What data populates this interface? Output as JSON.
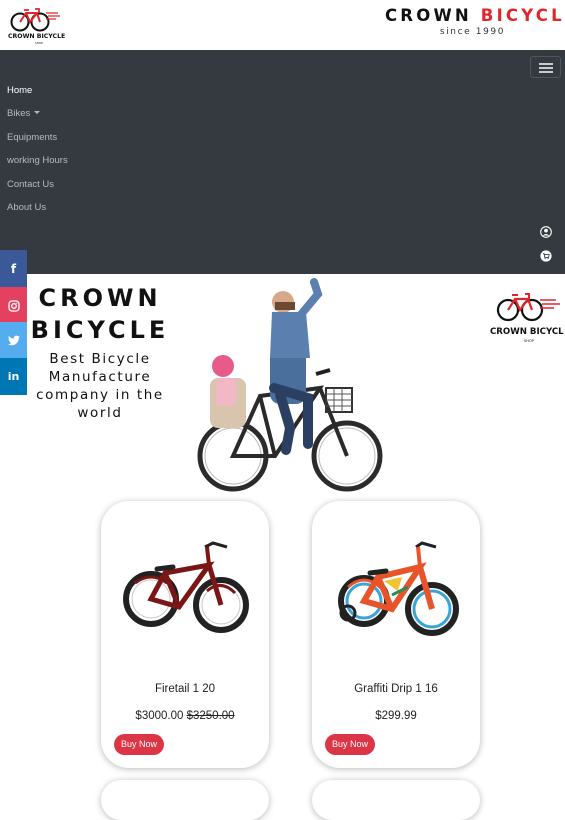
{
  "header": {
    "brand_word1": "CROWN ",
    "brand_word2": "BICYCLE",
    "since": "since 1990",
    "logo_text": "CROWN BICYCLE",
    "logo_sub": "SHOP"
  },
  "nav": {
    "toggle_icon": "hamburger-icon",
    "items": [
      {
        "label": "Home",
        "active": true
      },
      {
        "label": "Bikes",
        "dropdown": true
      },
      {
        "label": "Equipments"
      },
      {
        "label": "working Hours"
      },
      {
        "label": "Contact Us"
      },
      {
        "label": "About Us"
      }
    ],
    "icons": [
      "user-circle-icon",
      "cart-icon"
    ]
  },
  "social": [
    {
      "name": "facebook-icon",
      "glyph": "f",
      "color": "#3b5998"
    },
    {
      "name": "instagram-icon",
      "glyph": "◎",
      "color": "#e4405f"
    },
    {
      "name": "twitter-icon",
      "glyph": "🐦",
      "color": "#55acee"
    },
    {
      "name": "linkedin-icon",
      "glyph": "in",
      "color": "#0077b5"
    }
  ],
  "hero": {
    "title_line1": "CROWN",
    "title_line2": "BICYCLE",
    "tagline": "Best Bicycle Manufacture company in the world",
    "logo_text": "CROWN BICYCL",
    "logo_sub": "SHOP"
  },
  "products": [
    {
      "name": "Firetail 1 20",
      "price": "$3000.00",
      "old_price": "$3250.00",
      "button": "Buy Now",
      "color": "#7a1616"
    },
    {
      "name": "Graffiti Drip 1 16",
      "price": "$299.99",
      "old_price": "",
      "button": "Buy Now",
      "color": "#e8542a"
    }
  ],
  "colors": {
    "navbar": "#343a40",
    "accent": "#dc3545",
    "brand_red": "#e0252b"
  }
}
